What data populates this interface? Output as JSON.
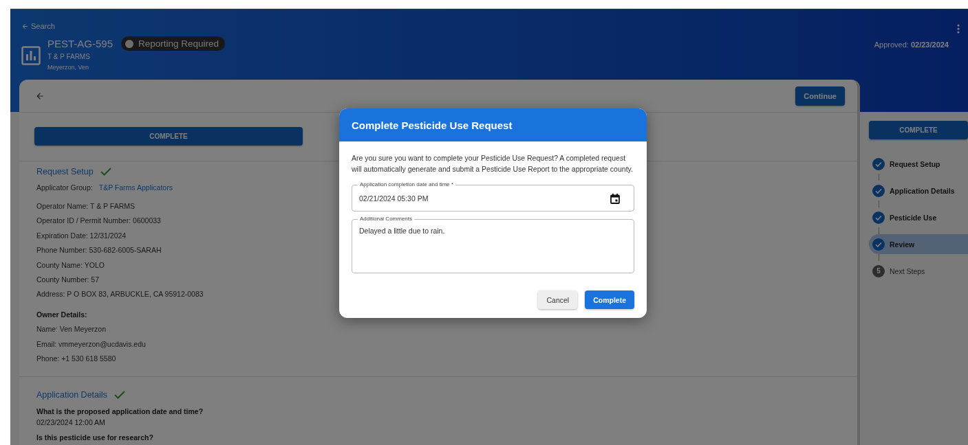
{
  "header": {
    "back_link": "Search",
    "record_id": "PEST-AG-595",
    "status": {
      "label": "Reporting Required"
    },
    "farm": "T & P FARMS",
    "owner": "Meyerzon, Ven",
    "approved_label": "Approved:",
    "approved_date": "02/23/2024"
  },
  "toolbar": {
    "continue_button": "Continue"
  },
  "complete_button": "COMPLETE",
  "request_setup": {
    "title": "Request Setup",
    "done": true,
    "applicator_group": {
      "label": "Applicator Group:",
      "value": "T&P Farms Applicators"
    },
    "fields": [
      "Operator Name: T & P FARMS",
      "Operator ID / Permit Number: 0600033",
      "Expiration Date: 12/31/2024",
      "Phone Number: 530-682-6005-SARAH",
      "County Name: YOLO",
      "County Number: 57",
      "Address: P O BOX 83, ARBUCKLE, CA 95912-0083"
    ],
    "owner_heading": "Owner Details:",
    "owner_fields": [
      "Name:  Ven Meyerzon",
      "Email:  vmmeyerzon@ucdavis.edu",
      "Phone:  +1 530 618 5580"
    ]
  },
  "application_details": {
    "title": "Application Details",
    "done": true,
    "questions": [
      {
        "question": "What is the proposed application date and time?",
        "answer": "02/23/2024 12:00 AM"
      },
      {
        "question": "Is this pesticide use for research?"
      }
    ]
  },
  "sidebar": {
    "complete_button": "COMPLETE",
    "steps": [
      {
        "label": "Request Setup",
        "done": true,
        "selected": false
      },
      {
        "label": "Application Details",
        "done": true,
        "selected": false
      },
      {
        "label": "Pesticide Use",
        "done": true,
        "selected": false
      },
      {
        "label": "Review",
        "done": true,
        "selected": true
      },
      {
        "label": "Next Steps",
        "done": false,
        "selected": false,
        "number": "5"
      }
    ]
  },
  "dialog": {
    "title": "Complete Pesticide Use Request",
    "message": "Are you sure you want to complete your Pesticide Use Request? A completed request will automatically generate and submit a Pesticide Use Report to the appropriate county.",
    "date_field": {
      "label": "Application completion date and time *",
      "value": "02/21/2024 05:30 PM"
    },
    "comments_field": {
      "label": "Additional Comments",
      "value": "Delayed a little due to rain."
    },
    "cancel_button": "Cancel",
    "complete_button": "Complete"
  }
}
